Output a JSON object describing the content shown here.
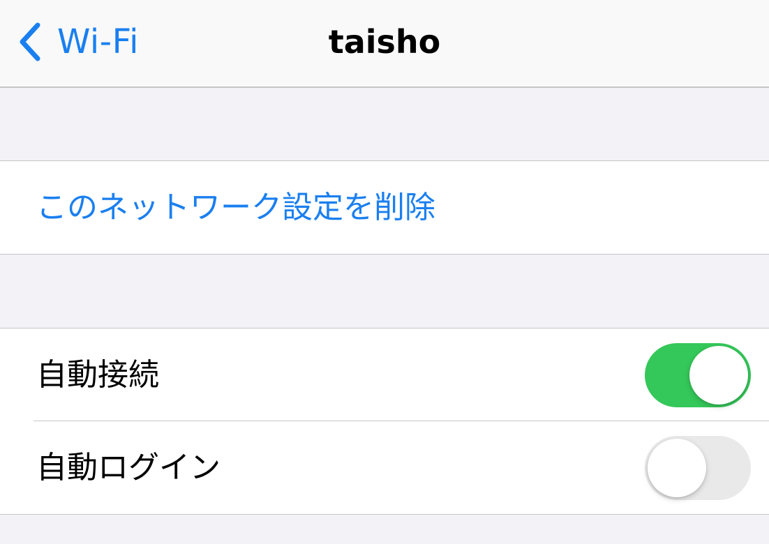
{
  "nav": {
    "back_label": "Wi-Fi",
    "title": "taisho"
  },
  "forget_section": {
    "forget_label": "このネットワーク設定を削除"
  },
  "settings": {
    "auto_join": {
      "label": "自動接続",
      "enabled": true
    },
    "auto_login": {
      "label": "自動ログイン",
      "enabled": false
    }
  },
  "colors": {
    "accent": "#1a7ff0",
    "toggle_on": "#34c759",
    "toggle_off": "#e9e9ea",
    "background": "#f2f2f7"
  },
  "icons": {
    "back": "chevron-left-icon"
  }
}
